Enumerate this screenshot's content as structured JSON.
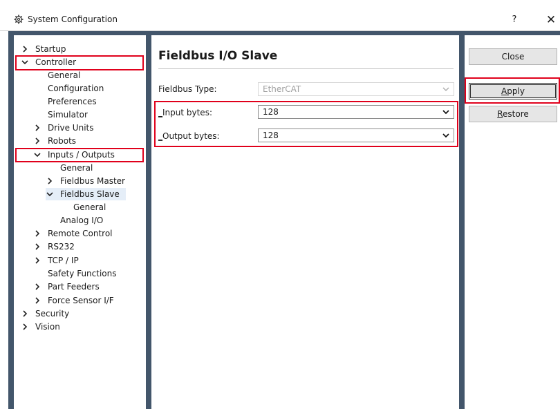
{
  "window": {
    "title": "System Configuration",
    "help_label": "?",
    "close_label": "✕"
  },
  "tree": {
    "items": [
      {
        "label": "Startup",
        "expander": "collapsed"
      },
      {
        "label": "Controller",
        "expander": "expanded"
      },
      {
        "label": "General",
        "expander": "none"
      },
      {
        "label": "Configuration",
        "expander": "none"
      },
      {
        "label": "Preferences",
        "expander": "none"
      },
      {
        "label": "Simulator",
        "expander": "none"
      },
      {
        "label": "Drive Units",
        "expander": "collapsed"
      },
      {
        "label": "Robots",
        "expander": "collapsed"
      },
      {
        "label": "Inputs / Outputs",
        "expander": "expanded"
      },
      {
        "label": "General",
        "expander": "none"
      },
      {
        "label": "Fieldbus Master",
        "expander": "collapsed"
      },
      {
        "label": "Fieldbus Slave",
        "expander": "expanded",
        "selected": true
      },
      {
        "label": "General",
        "expander": "none"
      },
      {
        "label": "Analog I/O",
        "expander": "none"
      },
      {
        "label": "Remote Control",
        "expander": "collapsed"
      },
      {
        "label": "RS232",
        "expander": "collapsed"
      },
      {
        "label": "TCP / IP",
        "expander": "collapsed"
      },
      {
        "label": "Safety Functions",
        "expander": "none"
      },
      {
        "label": "Part Feeders",
        "expander": "collapsed"
      },
      {
        "label": "Force Sensor I/F",
        "expander": "collapsed"
      },
      {
        "label": "Security",
        "expander": "collapsed"
      },
      {
        "label": "Vision",
        "expander": "collapsed"
      }
    ]
  },
  "content": {
    "title": "Fieldbus I/O Slave",
    "fieldbus_type": {
      "label": "Fieldbus Type:",
      "value": "EtherCAT"
    },
    "input_bytes": {
      "label_prefix": "_",
      "label_rest": "Input bytes:",
      "value": "128"
    },
    "output_bytes": {
      "label_prefix": "_",
      "label_rest": "Output bytes:",
      "value": "128"
    }
  },
  "buttons": {
    "close": "Close",
    "apply_first": "A",
    "apply_rest": "pply",
    "restore_first": "R",
    "restore_rest": "estore"
  },
  "colors": {
    "frame": "#43566b",
    "highlight": "#e0001b",
    "selection": "#e5eef8"
  }
}
